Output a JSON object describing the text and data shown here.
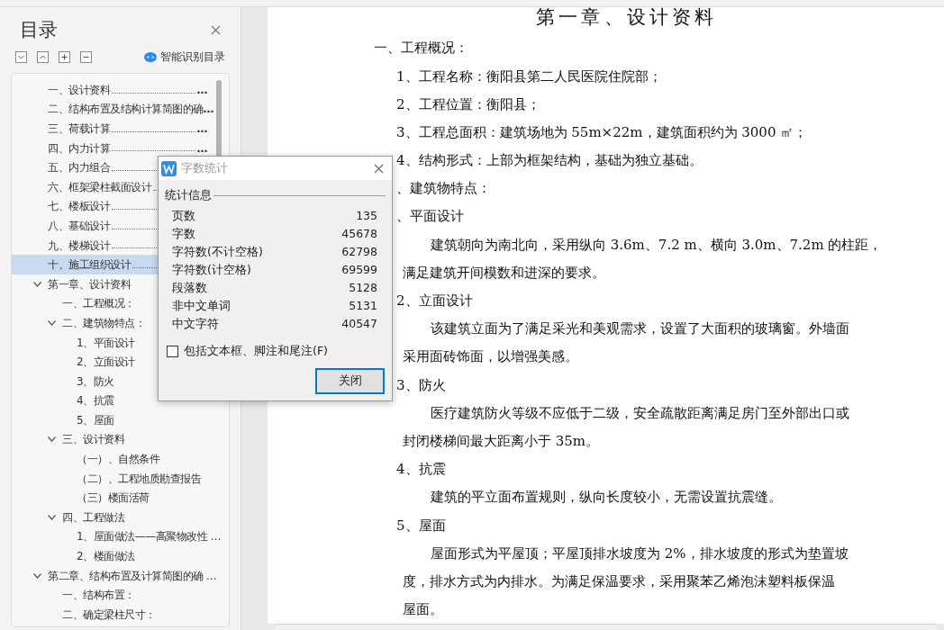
{
  "sidebar": {
    "title": "目录",
    "smart_label": "智能识别目录",
    "items": [
      {
        "label": "一、设计资料",
        "leader": true,
        "trail": "…",
        "selected": false
      },
      {
        "label": "二、结构布置及结构计算简图的确",
        "leader": false,
        "trail": "…",
        "selected": false
      },
      {
        "label": "三、荷载计算",
        "leader": true,
        "trail": "…",
        "selected": false
      },
      {
        "label": "四、内力计算",
        "leader": true,
        "trail": "…",
        "selected": false
      },
      {
        "label": "五、内力组合",
        "leader": true,
        "selected": false
      },
      {
        "label": "六、框架梁柱截面设计",
        "leader": true,
        "selected": false
      },
      {
        "label": "七、楼板设计",
        "leader": true,
        "selected": false
      },
      {
        "label": "八、基础设计",
        "leader": true,
        "selected": false
      },
      {
        "label": "九、楼梯设计",
        "leader": true,
        "selected": false
      },
      {
        "label": "十、施工组织设计",
        "leader": true,
        "selected": true
      },
      {
        "label": "第一章、设计资料",
        "selected": false,
        "expanded": true,
        "children": [
          {
            "label": "一、工程概况：",
            "selected": false
          },
          {
            "label": "二、建筑物特点：",
            "selected": false,
            "expanded": true,
            "children": [
              {
                "label": "1、平面设计",
                "selected": false
              },
              {
                "label": "2、立面设计",
                "selected": false
              },
              {
                "label": "3、防火",
                "selected": false
              },
              {
                "label": "4、抗震",
                "selected": false
              },
              {
                "label": "5、屋面",
                "selected": false
              }
            ]
          },
          {
            "label": "三、设计资料",
            "selected": false,
            "expanded": true,
            "children": [
              {
                "label": "（一）、自然条件",
                "selected": false
              },
              {
                "label": "（二）、工程地质勘查报告",
                "selected": false
              },
              {
                "label": "（三）楼面活荷",
                "selected": false
              }
            ]
          },
          {
            "label": "四、工程做法",
            "selected": false,
            "expanded": true,
            "children": [
              {
                "label": "1、屋面做法——高聚物改性 …",
                "selected": false
              },
              {
                "label": "2、楼面做法",
                "selected": false
              }
            ]
          }
        ]
      },
      {
        "label": "第二章、结构布置及计算简图的确 …",
        "selected": false,
        "expanded": true,
        "children": [
          {
            "label": "一、结构布置：",
            "selected": false
          },
          {
            "label": "二、确定梁柱尺寸：",
            "selected": false
          }
        ]
      }
    ]
  },
  "document": {
    "title": "第一章、设计资料",
    "lines": [
      {
        "kind": "heading",
        "text": "一、工程概况："
      },
      {
        "kind": "item",
        "text": "1、工程名称：衡阳县第二人民医院住院部；"
      },
      {
        "kind": "item",
        "text": "2、工程位置：衡阳县；"
      },
      {
        "kind": "item",
        "text": "3、工程总面积：建筑场地为 55m×22m，建筑面积约为 3000 ㎡；"
      },
      {
        "kind": "item",
        "text": "4、结构形式：上部为框架结构，基础为独立基础。"
      },
      {
        "kind": "item",
        "text": "、建筑物特点："
      },
      {
        "kind": "item",
        "text": "、平面设计"
      },
      {
        "kind": "body",
        "text": "建筑朝向为南北向，采用纵向 3.6m、7.2 m、横向 3.0m、7.2m 的柱距，"
      },
      {
        "kind": "cont",
        "text": "满足建筑开间模数和进深的要求。"
      },
      {
        "kind": "item",
        "text": "2、立面设计"
      },
      {
        "kind": "body",
        "text": "该建筑立面为了满足采光和美观需求，设置了大面积的玻璃窗。外墙面"
      },
      {
        "kind": "cont",
        "text": "采用面砖饰面，以增强美感。"
      },
      {
        "kind": "item",
        "text": "3、防火"
      },
      {
        "kind": "body",
        "text": "医疗建筑防火等级不应低于二级，安全疏散距离满足房门至外部出口或"
      },
      {
        "kind": "cont",
        "text": "封闭楼梯间最大距离小于 35m。"
      },
      {
        "kind": "item",
        "text": "4、抗震"
      },
      {
        "kind": "body",
        "text": "建筑的平立面布置规则，纵向长度较小，无需设置抗震缝。"
      },
      {
        "kind": "item",
        "text": "5、屋面"
      },
      {
        "kind": "body",
        "text": "屋面形式为平屋顶；平屋顶排水坡度为 2%，排水坡度的形式为垫置坡"
      },
      {
        "kind": "cont",
        "text": "度，排水方式为内排水。为满足保温要求，采用聚苯乙烯泡沫塑料板保温"
      },
      {
        "kind": "cont",
        "text": "屋面。"
      }
    ]
  },
  "dialog": {
    "title": "字数统计",
    "group": "统计信息",
    "stats": [
      {
        "label": "页数",
        "value": "135"
      },
      {
        "label": "字数",
        "value": "45678"
      },
      {
        "label": "字符数(不计空格)",
        "value": "62798"
      },
      {
        "label": "字符数(计空格)",
        "value": "69599"
      },
      {
        "label": "段落数",
        "value": "5128"
      },
      {
        "label": "非中文单词",
        "value": "5131"
      },
      {
        "label": "中文字符",
        "value": "40547"
      }
    ],
    "checkbox": {
      "label": "包括文本框、脚注和尾注(F)",
      "checked": false
    },
    "button": {
      "label": "关闭",
      "focused": true
    }
  }
}
